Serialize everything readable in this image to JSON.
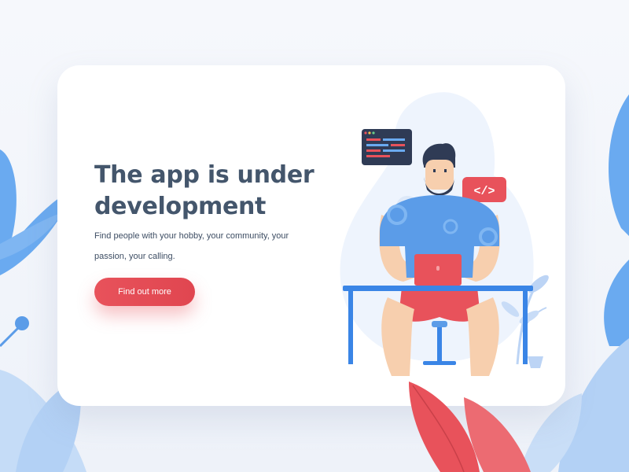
{
  "hero": {
    "headline": "The app is under development",
    "subtitle": "Find people with your hobby, your community, your passion, your calling.",
    "cta_label": "Find out more"
  },
  "illustration": {
    "code_badge": "</>"
  },
  "colors": {
    "accent": "#e8525b",
    "heading": "#44566c",
    "text": "#3d4d63",
    "leaf_blue": "#6aaaf0",
    "leaf_light": "#bcd6f5",
    "desk_blue": "#3a85e6"
  },
  "icons": [
    "code-window-icon",
    "code-tag-icon",
    "laptop-icon"
  ]
}
